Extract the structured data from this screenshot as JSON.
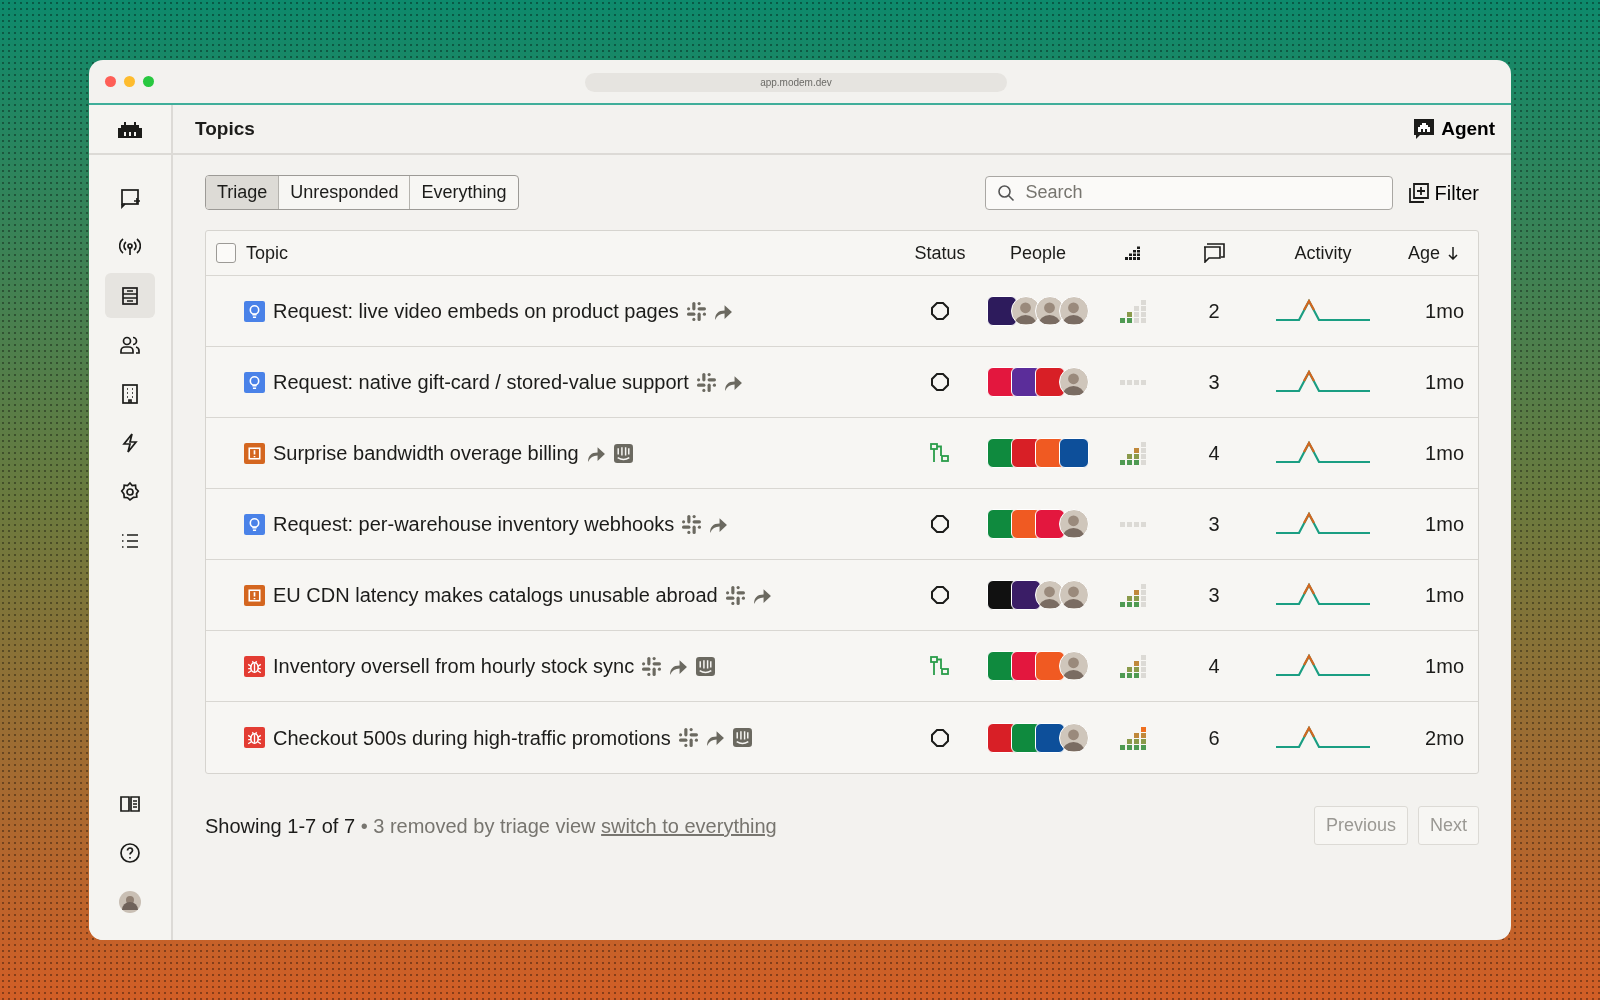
{
  "browser": {
    "url": "app.modem.dev"
  },
  "sidebar": {
    "items": [
      {
        "kind": "compose",
        "selected": false
      },
      {
        "kind": "broadcast",
        "selected": false
      },
      {
        "kind": "inbox",
        "selected": true
      },
      {
        "kind": "people",
        "selected": false
      },
      {
        "kind": "building",
        "selected": false
      },
      {
        "kind": "bolt",
        "selected": false
      },
      {
        "kind": "settings",
        "selected": false
      },
      {
        "kind": "list",
        "selected": false
      }
    ],
    "bottom_items": [
      {
        "kind": "book"
      },
      {
        "kind": "help"
      },
      {
        "kind": "avatar"
      }
    ]
  },
  "header": {
    "title": "Topics",
    "agent_button": "Agent"
  },
  "tabs": [
    {
      "label": "Triage",
      "selected": true
    },
    {
      "label": "Unresponded",
      "selected": false
    },
    {
      "label": "Everything",
      "selected": false
    }
  ],
  "search": {
    "placeholder": "Search"
  },
  "filter_button": "Filter",
  "table": {
    "select_all_checked": false,
    "columns": [
      {
        "kind": "topic",
        "label": "Topic"
      },
      {
        "kind": "text",
        "label": "Status"
      },
      {
        "kind": "text",
        "label": "People"
      },
      {
        "kind": "priority"
      },
      {
        "kind": "comments"
      },
      {
        "kind": "text",
        "label": "Activity"
      },
      {
        "kind": "sorted",
        "label": "Age"
      }
    ],
    "rows": [
      {
        "kind": "request",
        "title": "Request: live video embeds on product pages",
        "sources": [
          {
            "kind": "slack"
          },
          {
            "kind": "forward"
          }
        ],
        "status": {
          "kind": "open"
        },
        "people": [
          {
            "kind": "logo",
            "color": "#2d1b5c"
          },
          {
            "kind": "person"
          },
          {
            "kind": "person"
          },
          {
            "kind": "person"
          }
        ],
        "priority": {
          "kind": "low"
        },
        "comments": "2",
        "age": "1mo"
      },
      {
        "kind": "request",
        "title": "Request: native gift-card / stored-value support",
        "sources": [
          {
            "kind": "slack"
          },
          {
            "kind": "forward"
          }
        ],
        "status": {
          "kind": "open"
        },
        "people": [
          {
            "kind": "logo",
            "color": "#e3173e"
          },
          {
            "kind": "logo",
            "color": "#5b2d9a"
          },
          {
            "kind": "logo",
            "color": "#d81f26"
          },
          {
            "kind": "person"
          }
        ],
        "priority": {
          "kind": "none"
        },
        "comments": "3",
        "age": "1mo"
      },
      {
        "kind": "issue",
        "title": "Surprise bandwidth overage billing",
        "sources": [
          {
            "kind": "forward"
          },
          {
            "kind": "intercom"
          }
        ],
        "status": {
          "kind": "linked"
        },
        "people": [
          {
            "kind": "logo",
            "color": "#0f8a3e"
          },
          {
            "kind": "logo",
            "color": "#d81f26"
          },
          {
            "kind": "logo",
            "color": "#f05a22"
          },
          {
            "kind": "logo",
            "color": "#0d4f9a"
          }
        ],
        "priority": {
          "kind": "medium"
        },
        "comments": "4",
        "age": "1mo"
      },
      {
        "kind": "request",
        "title": "Request: per-warehouse inventory webhooks",
        "sources": [
          {
            "kind": "slack"
          },
          {
            "kind": "forward"
          }
        ],
        "status": {
          "kind": "open"
        },
        "people": [
          {
            "kind": "logo",
            "color": "#0f8a3e"
          },
          {
            "kind": "logo",
            "color": "#f05a22"
          },
          {
            "kind": "logo",
            "color": "#e3173e"
          },
          {
            "kind": "person"
          }
        ],
        "priority": {
          "kind": "none"
        },
        "comments": "3",
        "age": "1mo"
      },
      {
        "kind": "issue",
        "title": "EU CDN latency makes catalogs unusable abroad",
        "sources": [
          {
            "kind": "slack"
          },
          {
            "kind": "forward"
          }
        ],
        "status": {
          "kind": "open"
        },
        "people": [
          {
            "kind": "logo",
            "color": "#111111"
          },
          {
            "kind": "logo",
            "color": "#3a1d66"
          },
          {
            "kind": "person"
          },
          {
            "kind": "person"
          }
        ],
        "priority": {
          "kind": "medium"
        },
        "comments": "3",
        "age": "1mo"
      },
      {
        "kind": "bug",
        "title": "Inventory oversell from hourly stock sync",
        "sources": [
          {
            "kind": "slack"
          },
          {
            "kind": "forward"
          },
          {
            "kind": "intercom"
          }
        ],
        "status": {
          "kind": "linked"
        },
        "people": [
          {
            "kind": "logo",
            "color": "#0f8a3e"
          },
          {
            "kind": "logo",
            "color": "#e3173e"
          },
          {
            "kind": "logo",
            "color": "#f05a22"
          },
          {
            "kind": "person"
          }
        ],
        "priority": {
          "kind": "medium"
        },
        "comments": "4",
        "age": "1mo"
      },
      {
        "kind": "bug",
        "title": "Checkout 500s during high-traffic promotions",
        "sources": [
          {
            "kind": "slack"
          },
          {
            "kind": "forward"
          },
          {
            "kind": "intercom"
          }
        ],
        "status": {
          "kind": "open"
        },
        "people": [
          {
            "kind": "logo",
            "color": "#d81f26"
          },
          {
            "kind": "logo",
            "color": "#0f8a3e"
          },
          {
            "kind": "logo",
            "color": "#0d4f9a"
          },
          {
            "kind": "person"
          }
        ],
        "priority": {
          "kind": "high"
        },
        "comments": "6",
        "age": "2mo"
      }
    ]
  },
  "footer": {
    "summary": "Showing 1-7 of 7",
    "note": "• 3 removed by triage view",
    "link": "switch to everything",
    "buttons": [
      {
        "label": "Previous",
        "disabled": true
      },
      {
        "label": "Next",
        "disabled": true
      }
    ]
  }
}
